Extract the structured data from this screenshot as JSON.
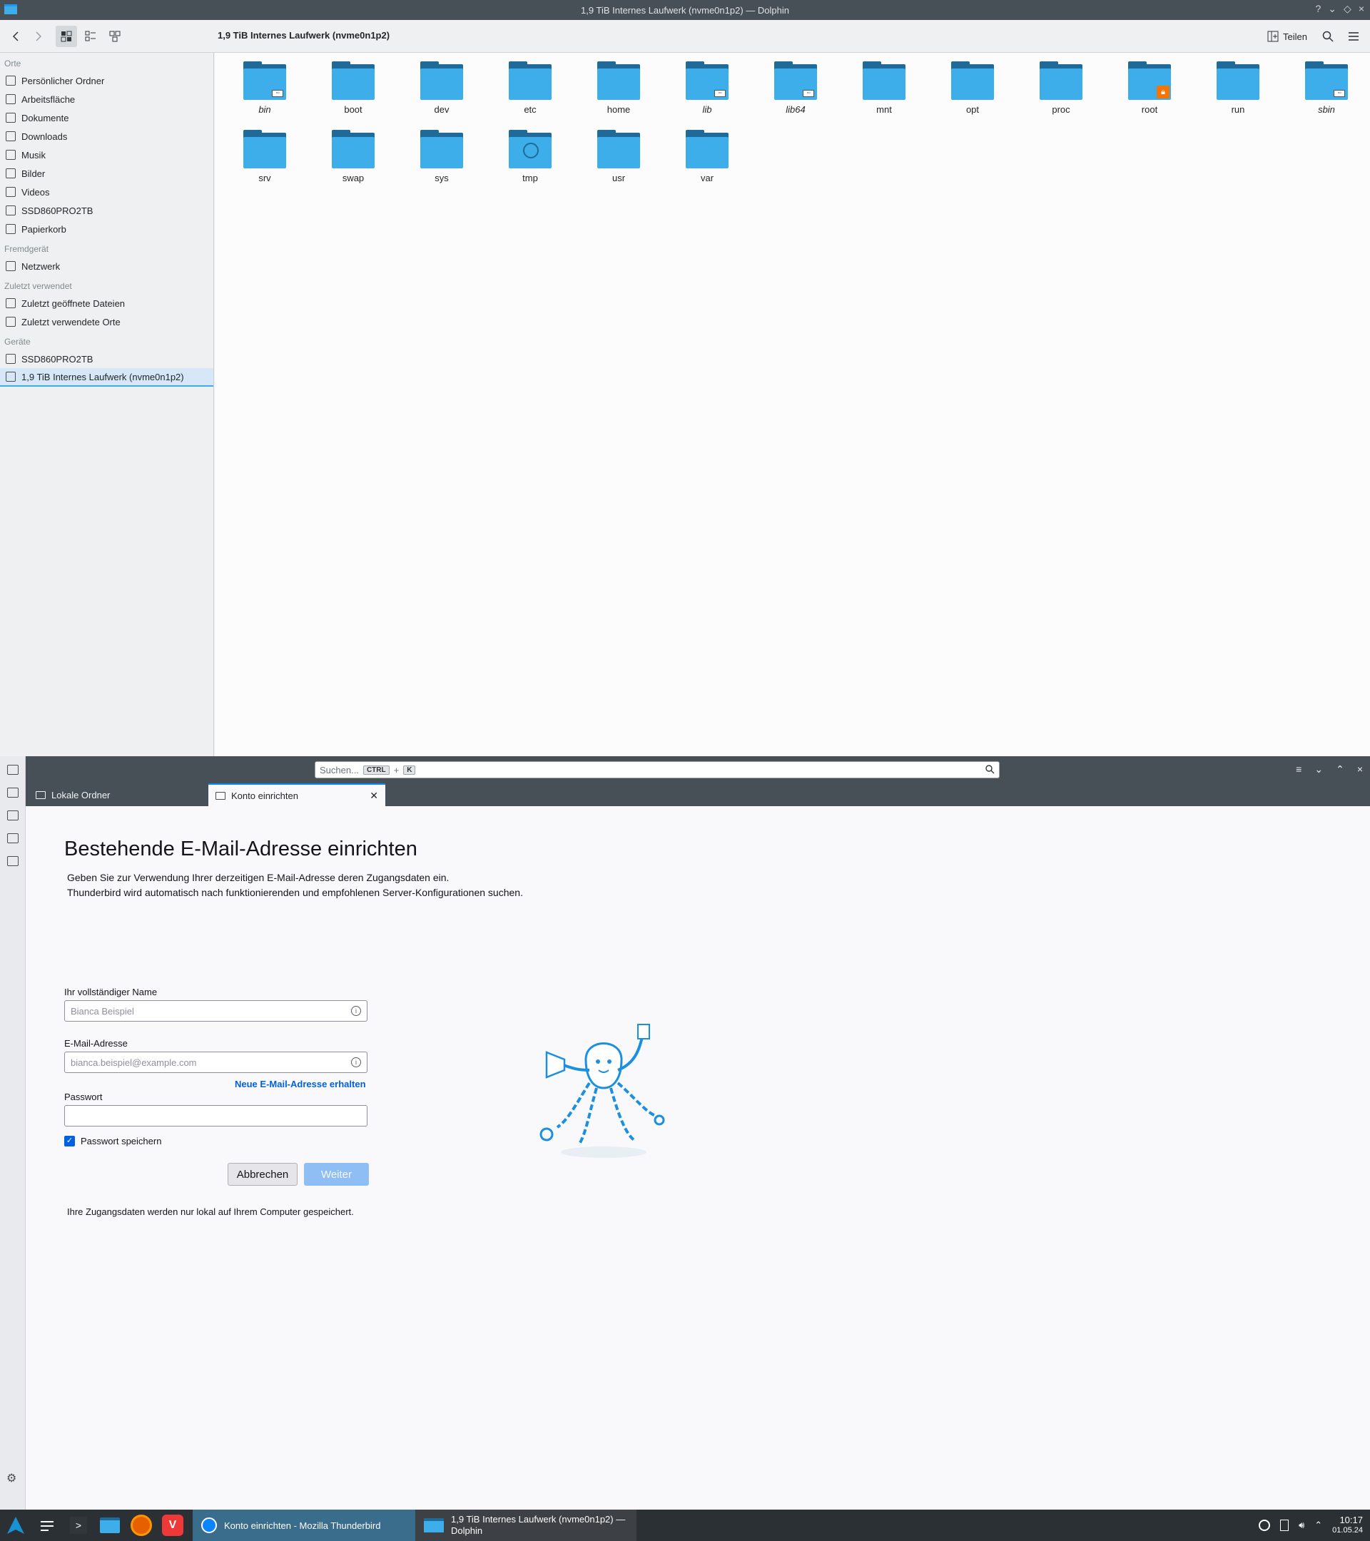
{
  "dolphin": {
    "title": "1,9 TiB Internes Laufwerk (nvme0n1p2) — Dolphin",
    "title_buttons": [
      "?",
      "⌄",
      "◇",
      "×"
    ],
    "location": "1,9 TiB Internes Laufwerk (nvme0n1p2)",
    "share_label": "Teilen",
    "sidebar": {
      "sections": [
        {
          "heading": "Orte",
          "items": [
            "Persönlicher Ordner",
            "Arbeitsfläche",
            "Dokumente",
            "Downloads",
            "Musik",
            "Bilder",
            "Videos",
            "SSD860PRO2TB",
            "Papierkorb"
          ]
        },
        {
          "heading": "Fremdgerät",
          "items": [
            "Netzwerk"
          ]
        },
        {
          "heading": "Zuletzt verwendet",
          "items": [
            "Zuletzt geöffnete Dateien",
            "Zuletzt verwendete Orte"
          ]
        },
        {
          "heading": "Geräte",
          "items": [
            "SSD860PRO2TB",
            "1,9 TiB Internes Laufwerk (nvme0n1p2)"
          ]
        }
      ],
      "selected": "1,9 TiB Internes Laufwerk (nvme0n1p2)"
    },
    "folders": [
      {
        "name": "bin",
        "italic": true,
        "emblem": "symlink"
      },
      {
        "name": "boot",
        "italic": false,
        "emblem": ""
      },
      {
        "name": "dev",
        "italic": false,
        "emblem": ""
      },
      {
        "name": "etc",
        "italic": false,
        "emblem": ""
      },
      {
        "name": "home",
        "italic": false,
        "emblem": ""
      },
      {
        "name": "lib",
        "italic": true,
        "emblem": "symlink"
      },
      {
        "name": "lib64",
        "italic": true,
        "emblem": "symlink"
      },
      {
        "name": "mnt",
        "italic": false,
        "emblem": ""
      },
      {
        "name": "opt",
        "italic": false,
        "emblem": ""
      },
      {
        "name": "proc",
        "italic": false,
        "emblem": ""
      },
      {
        "name": "root",
        "italic": false,
        "emblem": "lock"
      },
      {
        "name": "run",
        "italic": false,
        "emblem": ""
      },
      {
        "name": "sbin",
        "italic": true,
        "emblem": "symlink"
      },
      {
        "name": "srv",
        "italic": false,
        "emblem": ""
      },
      {
        "name": "swap",
        "italic": false,
        "emblem": ""
      },
      {
        "name": "sys",
        "italic": false,
        "emblem": ""
      },
      {
        "name": "tmp",
        "italic": false,
        "emblem": "clock"
      },
      {
        "name": "usr",
        "italic": false,
        "emblem": ""
      },
      {
        "name": "var",
        "italic": false,
        "emblem": ""
      }
    ]
  },
  "thunderbird": {
    "search_placeholder": "Suchen...",
    "search_kbd_1": "CTRL",
    "search_kbd_plus": "+",
    "search_kbd_2": "K",
    "tabs": [
      {
        "label": "Lokale Ordner"
      },
      {
        "label": "Konto einrichten"
      }
    ],
    "heading": "Bestehende E-Mail-Adresse einrichten",
    "intro_line1": "Geben Sie zur Verwendung Ihrer derzeitigen E-Mail-Adresse deren Zugangsdaten ein.",
    "intro_line2": "Thunderbird wird automatisch nach funktionierenden und empfohlenen Server-Konfigurationen suchen.",
    "name_label": "Ihr vollständiger Name",
    "name_placeholder": "Bianca Beispiel",
    "email_label": "E-Mail-Adresse",
    "email_placeholder": "bianca.beispiel@example.com",
    "new_email_link": "Neue E-Mail-Adresse erhalten",
    "password_label": "Passwort",
    "password_value": "",
    "remember_password": "Passwort speichern",
    "remember_checked": true,
    "cancel_label": "Abbrechen",
    "next_label": "Weiter",
    "footer_note": "Ihre Zugangsdaten werden nur lokal auf Ihrem Computer gespeichert."
  },
  "taskbar": {
    "tasks": [
      {
        "label": "Konto einrichten - Mozilla Thunderbird"
      },
      {
        "label_line1": "1,9 TiB Internes Laufwerk (nvme0n1p2) —",
        "label_line2": "Dolphin"
      }
    ],
    "time": "10:17",
    "date": "01.05.24"
  },
  "colors": {
    "accent": "#3daee9",
    "folder_front": "#3daee9",
    "folder_back": "#1e6a98",
    "titlebar": "#475057",
    "link": "#0061e0",
    "next_button": "#8fbef5",
    "taskbar": "#2b3034"
  }
}
